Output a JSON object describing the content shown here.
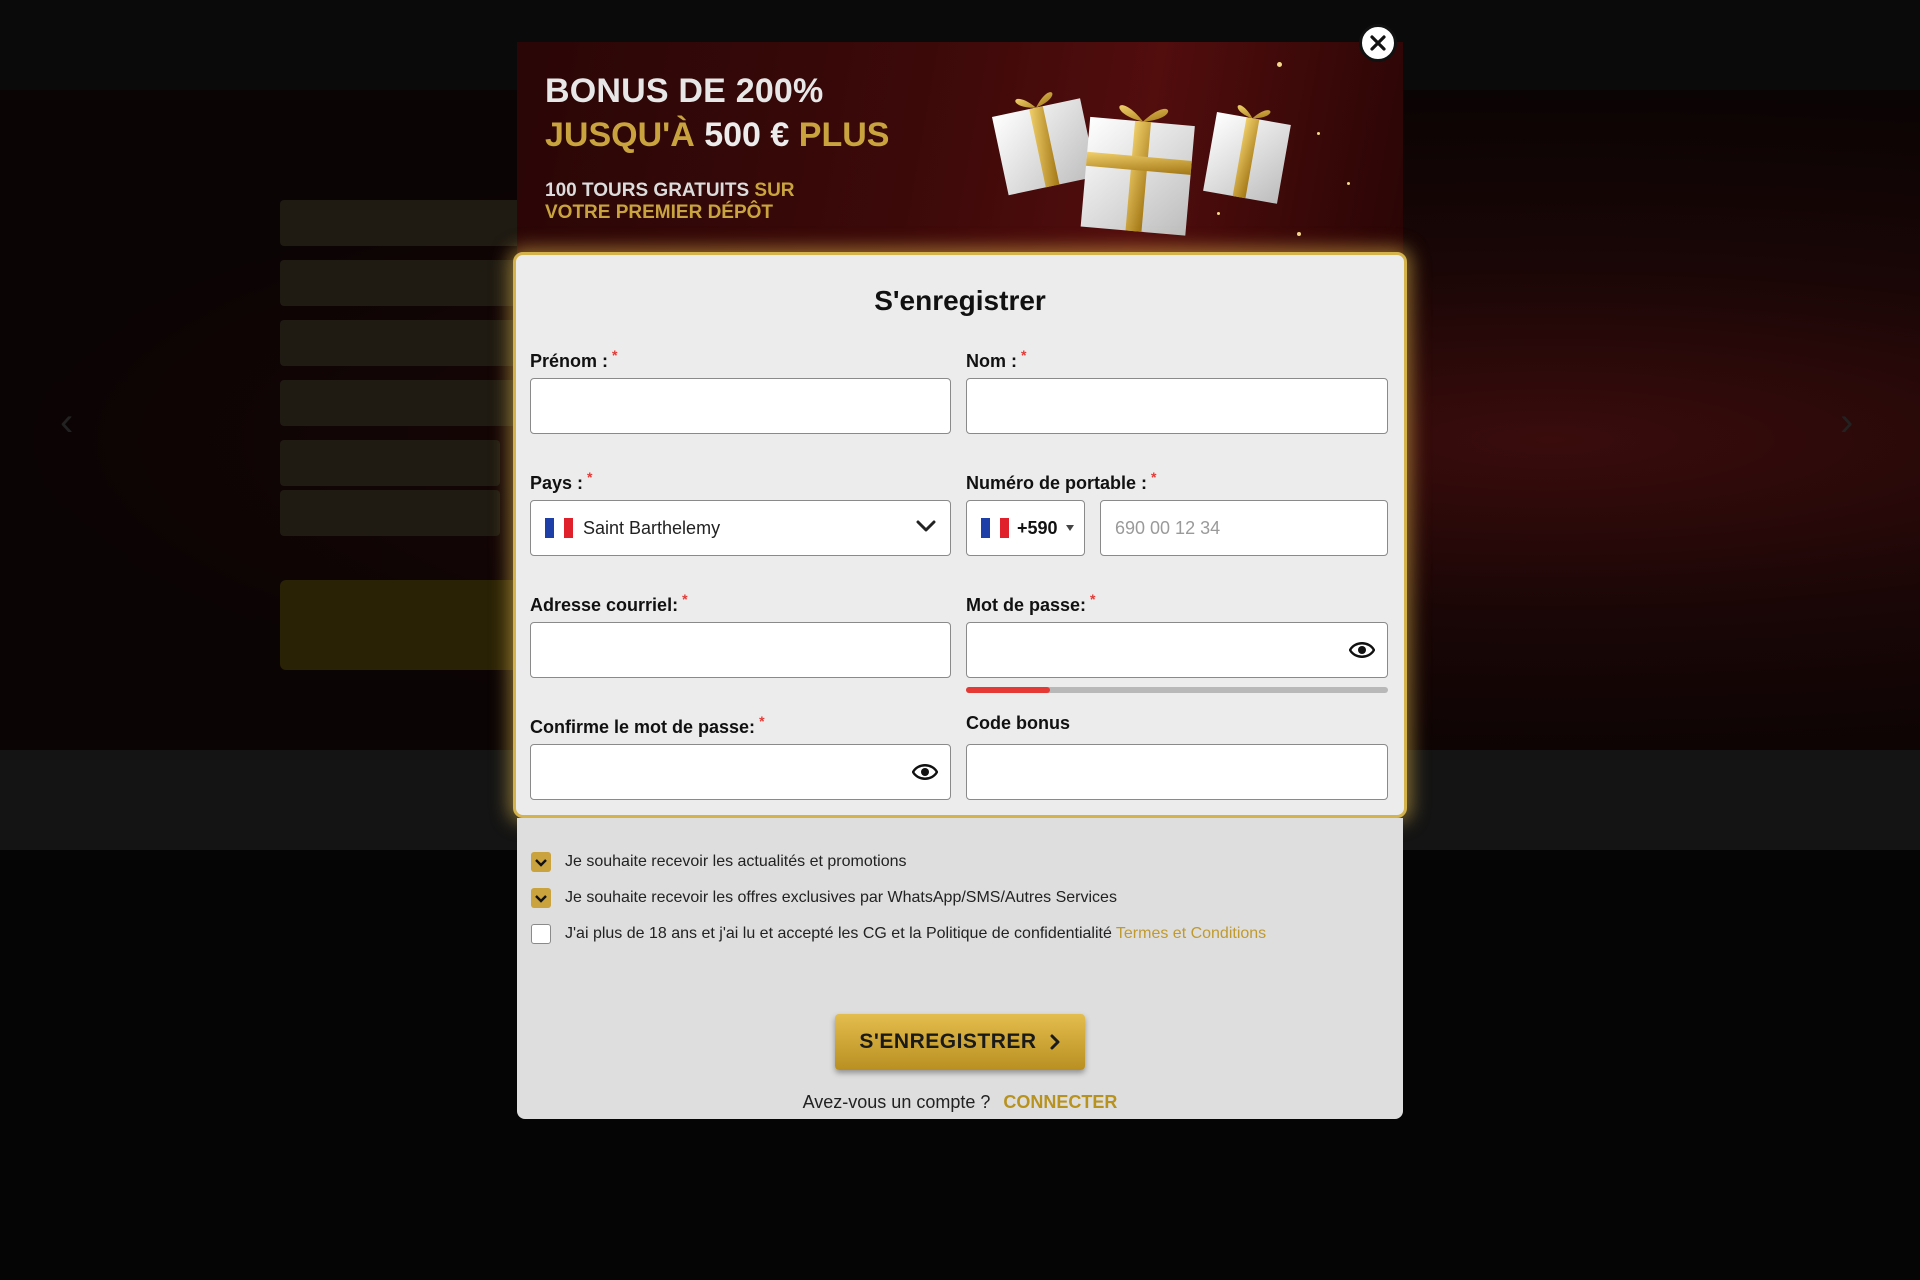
{
  "banner": {
    "line1": "BONUS DE 200%",
    "line2_a": "JUSQU'À",
    "line2_b": "500 €",
    "line2_c": "PLUS",
    "sub1_a": "100 TOURS GRATUITS",
    "sub1_b": "SUR",
    "sub2": "VOTRE PREMIER DÉPÔT"
  },
  "form": {
    "title": "S'enregistrer",
    "first_name_label": "Prénom :",
    "last_name_label": "Nom :",
    "country_label": "Pays :",
    "country_value": "Saint Barthelemy",
    "phone_label": "Numéro de portable :",
    "phone_code": "+590",
    "phone_placeholder": "690 00 12 34",
    "email_label": "Adresse courriel:",
    "password_label": "Mot de passe:",
    "password_strength": 0.2,
    "confirm_label": "Confirme le mot de passe:",
    "bonus_label": "Code bonus",
    "required_mark": "*"
  },
  "checkboxes": [
    {
      "label": "Je souhaite recevoir les actualités et promotions",
      "checked": true
    },
    {
      "label": "Je souhaite recevoir les offres exclusives par WhatsApp/SMS/Autres Services",
      "checked": true
    },
    {
      "label": "J'ai plus de 18 ans et j'ai lu et accepté les CG et la Politique de confidentialité",
      "checked": false
    }
  ],
  "terms_link": "Termes et Conditions",
  "submit_label": "S'ENREGISTRER",
  "account_question": "Avez-vous un compte ?",
  "connect_label": "CONNECTER",
  "colors": {
    "gold": "#c9a43e",
    "required": "#e53935",
    "flag_blue": "#1e3fa8",
    "flag_red": "#e0202a"
  }
}
